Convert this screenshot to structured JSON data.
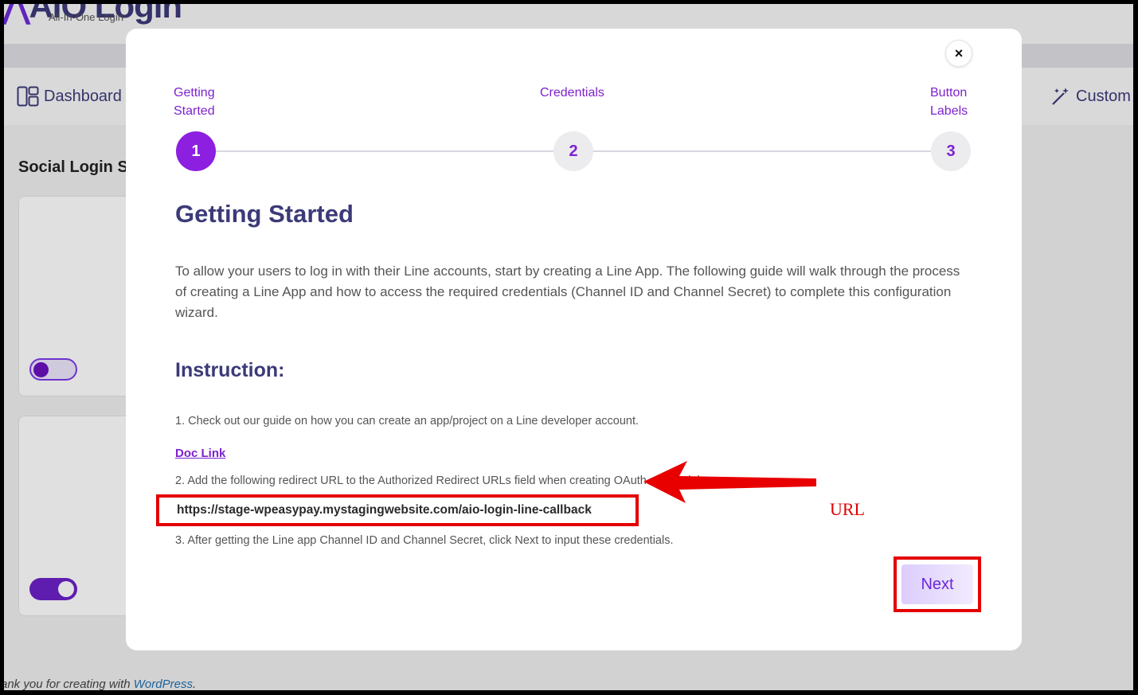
{
  "background": {
    "logo_title": "AIO Login",
    "logo_subtitle": "All-In-One Login",
    "nav": {
      "dashboard": "Dashboard",
      "customization": "Custom"
    },
    "section_title": "Social Login S",
    "toggles": [
      {
        "state": "off"
      },
      {
        "state": "on"
      }
    ],
    "footer": {
      "text": "ank you for creating with ",
      "link": "WordPress",
      "suffix": "."
    }
  },
  "modal": {
    "close_label": "×",
    "steps": [
      {
        "label_line1": "Getting",
        "label_line2": "Started",
        "number": "1",
        "active": true
      },
      {
        "label_line1": "Credentials",
        "label_line2": "",
        "number": "2",
        "active": false
      },
      {
        "label_line1": "Button",
        "label_line2": "Labels",
        "number": "3",
        "active": false
      }
    ],
    "title": "Getting Started",
    "intro": "To allow your users to log in with their Line accounts, start by creating a Line App. The following guide will walk through the process of creating a Line App and how to access the required credentials (Channel ID and Channel Secret) to complete this configuration wizard.",
    "instruction_heading": "Instruction:",
    "step1_text": "1. Check out our guide on how you can create an app/project on a Line developer account.",
    "doc_link": "Doc Link",
    "step2_text": "2. Add the following redirect URL to the Authorized Redirect URLs field when creating OAuth credentials.",
    "redirect_url": "https://stage-wpeasypay.mystagingwebsite.com/aio-login-line-callback",
    "step3_text": "3. After getting the Line app Channel ID and Channel Secret, click Next to input these credentials.",
    "next_label": "Next"
  },
  "annotation": {
    "label": "URL",
    "color": "#e00000"
  },
  "colors": {
    "accent": "#7e22ce",
    "heading": "#3c3a78",
    "highlight": "#e40000"
  }
}
